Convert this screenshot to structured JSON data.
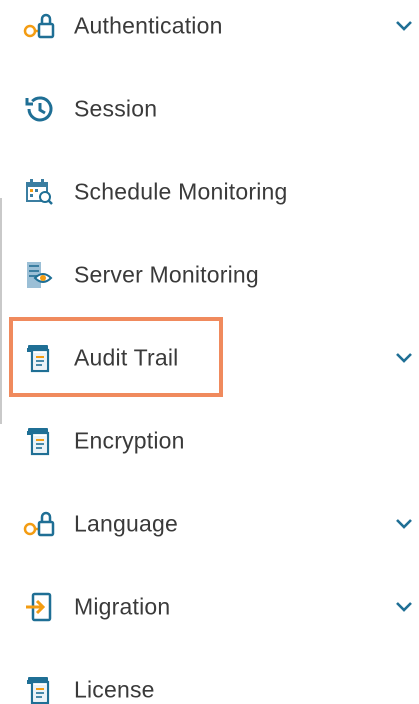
{
  "menu": {
    "items": [
      {
        "label": "Authentication",
        "icon": "lock-key-icon",
        "expandable": true
      },
      {
        "label": "Session",
        "icon": "history-clock-icon",
        "expandable": false
      },
      {
        "label": "Schedule Monitoring",
        "icon": "calendar-search-icon",
        "expandable": false
      },
      {
        "label": "Server Monitoring",
        "icon": "server-eye-icon",
        "expandable": false
      },
      {
        "label": "Audit Trail",
        "icon": "document-stack-icon",
        "expandable": true,
        "highlighted": true
      },
      {
        "label": "Encryption",
        "icon": "document-stack-icon",
        "expandable": false
      },
      {
        "label": "Language",
        "icon": "lock-key-icon",
        "expandable": true
      },
      {
        "label": "Migration",
        "icon": "import-arrow-icon",
        "expandable": true
      },
      {
        "label": "License",
        "icon": "document-stack-icon",
        "expandable": false
      }
    ]
  },
  "colors": {
    "icon_blue": "#1f6f95",
    "icon_orange": "#f39c12",
    "text": "#3a3a3a",
    "chevron": "#1f6f95",
    "highlight": "#f08a5d"
  }
}
